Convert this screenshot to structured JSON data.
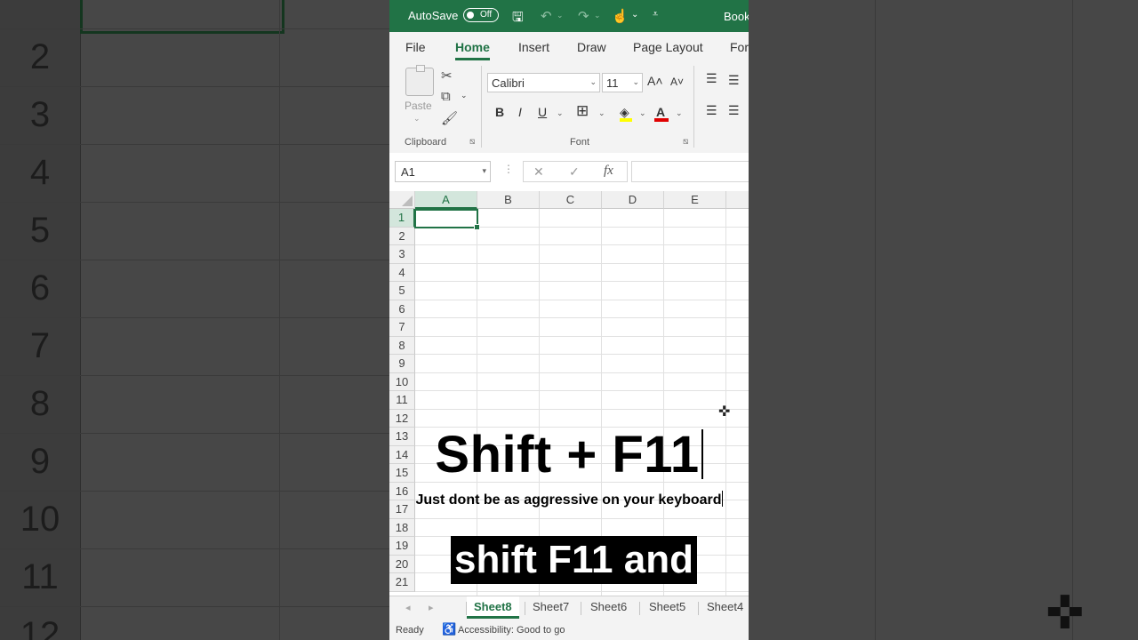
{
  "background": {
    "row_numbers": [
      "2",
      "3",
      "4",
      "5",
      "6",
      "7",
      "8",
      "9",
      "10",
      "11",
      "12"
    ]
  },
  "titlebar": {
    "autosave_label": "AutoSave",
    "toggle_state": "Off",
    "book_title": "Book"
  },
  "ribbon_tabs": [
    "File",
    "Home",
    "Insert",
    "Draw",
    "Page Layout",
    "For"
  ],
  "active_tab": "Home",
  "clipboard": {
    "paste_label": "Paste",
    "group_label": "Clipboard"
  },
  "font": {
    "font_name": "Calibri",
    "font_size": "11",
    "group_label": "Font",
    "bold": "B",
    "italic": "I",
    "underline": "U"
  },
  "formula_bar": {
    "name_box": "A1",
    "fx_label": "fx",
    "formula_value": ""
  },
  "grid": {
    "columns": [
      "A",
      "B",
      "C",
      "D",
      "E"
    ],
    "rows": [
      "1",
      "2",
      "3",
      "4",
      "5",
      "6",
      "7",
      "8",
      "9",
      "10",
      "11",
      "12",
      "13",
      "14",
      "15",
      "16",
      "17",
      "18",
      "19",
      "20",
      "21"
    ],
    "selected_cell": "A1"
  },
  "sheets": [
    "Sheet8",
    "Sheet7",
    "Sheet6",
    "Sheet5",
    "Sheet4"
  ],
  "active_sheet": "Sheet8",
  "status": {
    "ready": "Ready",
    "accessibility": "Accessibility: Good to go"
  },
  "captions": {
    "headline": "Shift + F11",
    "subline": "Just dont be as aggressive on your keyboard",
    "subtitle": "shift F11 and"
  },
  "colors": {
    "excel_green": "#217346",
    "highlight_yellow": "#ffff00",
    "font_red": "#e00000"
  }
}
